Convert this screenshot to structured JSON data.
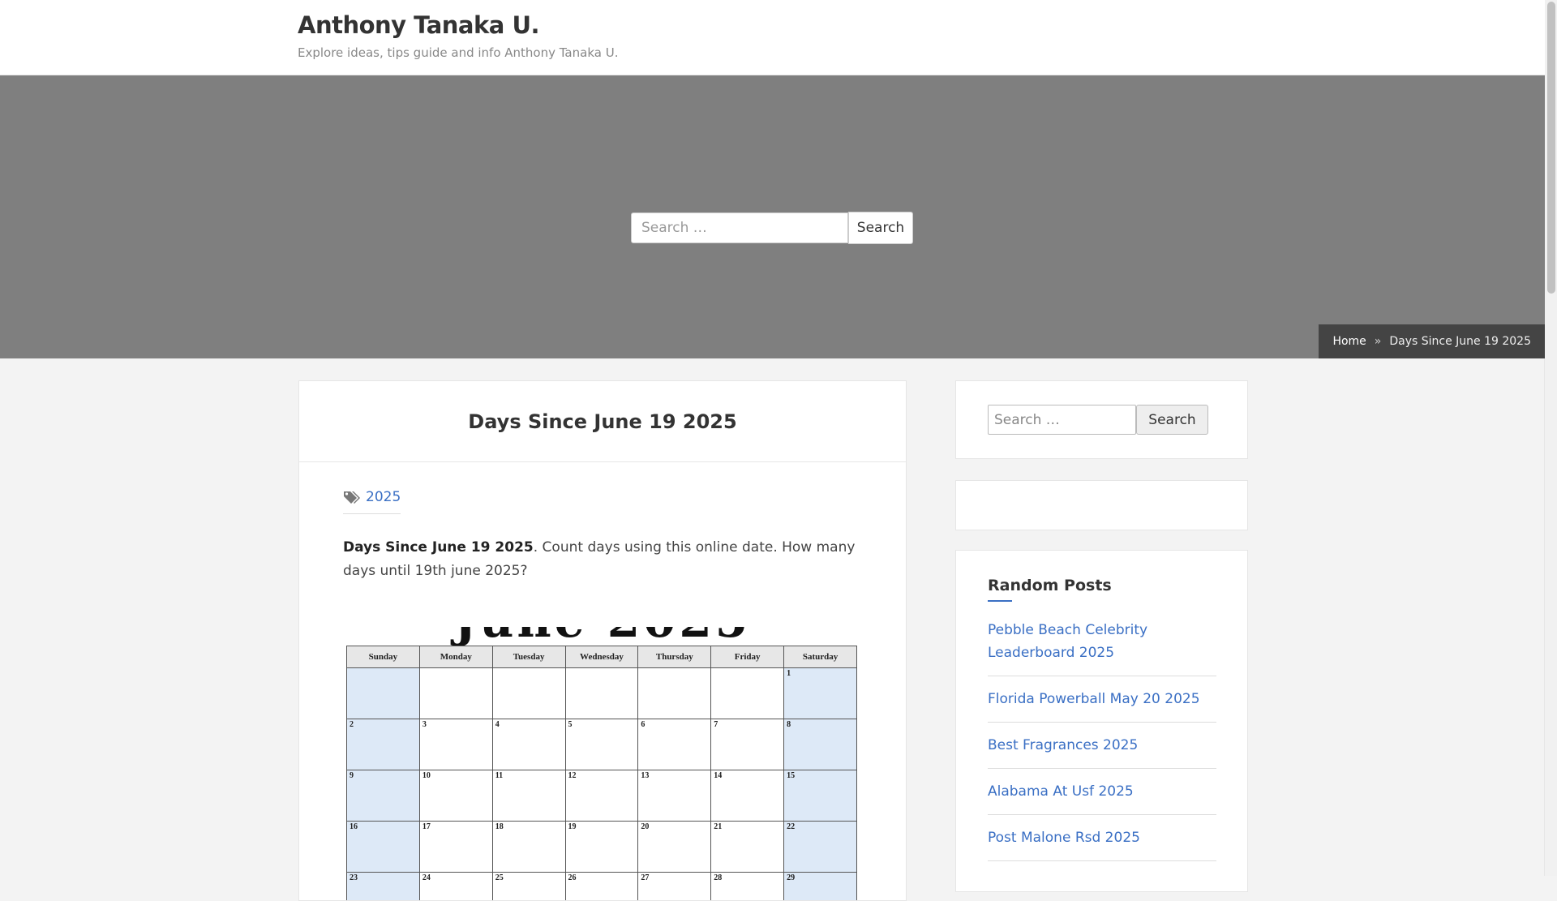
{
  "site": {
    "title": "Anthony Tanaka U.",
    "description": "Explore ideas, tips guide and info Anthony Tanaka U."
  },
  "hero": {
    "search_placeholder": "Search …",
    "search_button": "Search"
  },
  "breadcrumb": {
    "home": "Home",
    "separator": "»",
    "current": "Days Since June 19 2025"
  },
  "article": {
    "title": "Days Since June 19 2025",
    "tag": "2025",
    "intro_bold": "Days Since June 19 2025",
    "intro_text": ". Count days using this online date. How many days until 19th june 2025?"
  },
  "calendar": {
    "days": [
      "Sunday",
      "Monday",
      "Tuesday",
      "Wednesday",
      "Thursday",
      "Friday",
      "Saturday"
    ],
    "weeks": [
      [
        "",
        "",
        "",
        "",
        "",
        "",
        "1"
      ],
      [
        "2",
        "3",
        "4",
        "5",
        "6",
        "7",
        "8"
      ],
      [
        "9",
        "10",
        "11",
        "12",
        "13",
        "14",
        "15"
      ],
      [
        "16",
        "17",
        "18",
        "19",
        "20",
        "21",
        "22"
      ],
      [
        "23",
        "24",
        "25",
        "26",
        "27",
        "28",
        "29"
      ]
    ]
  },
  "sidebar": {
    "search_placeholder": "Search …",
    "search_button": "Search",
    "random_title": "Random Posts",
    "random_posts": [
      "Pebble Beach Celebrity Leaderboard 2025",
      "Florida Powerball May 20 2025",
      "Best Fragrances 2025",
      "Alabama At Usf 2025",
      "Post Malone Rsd 2025"
    ]
  },
  "colors": {
    "link": "#3a6fc4",
    "hero": "#7f7f7f",
    "breadcrumb": "#444444"
  }
}
